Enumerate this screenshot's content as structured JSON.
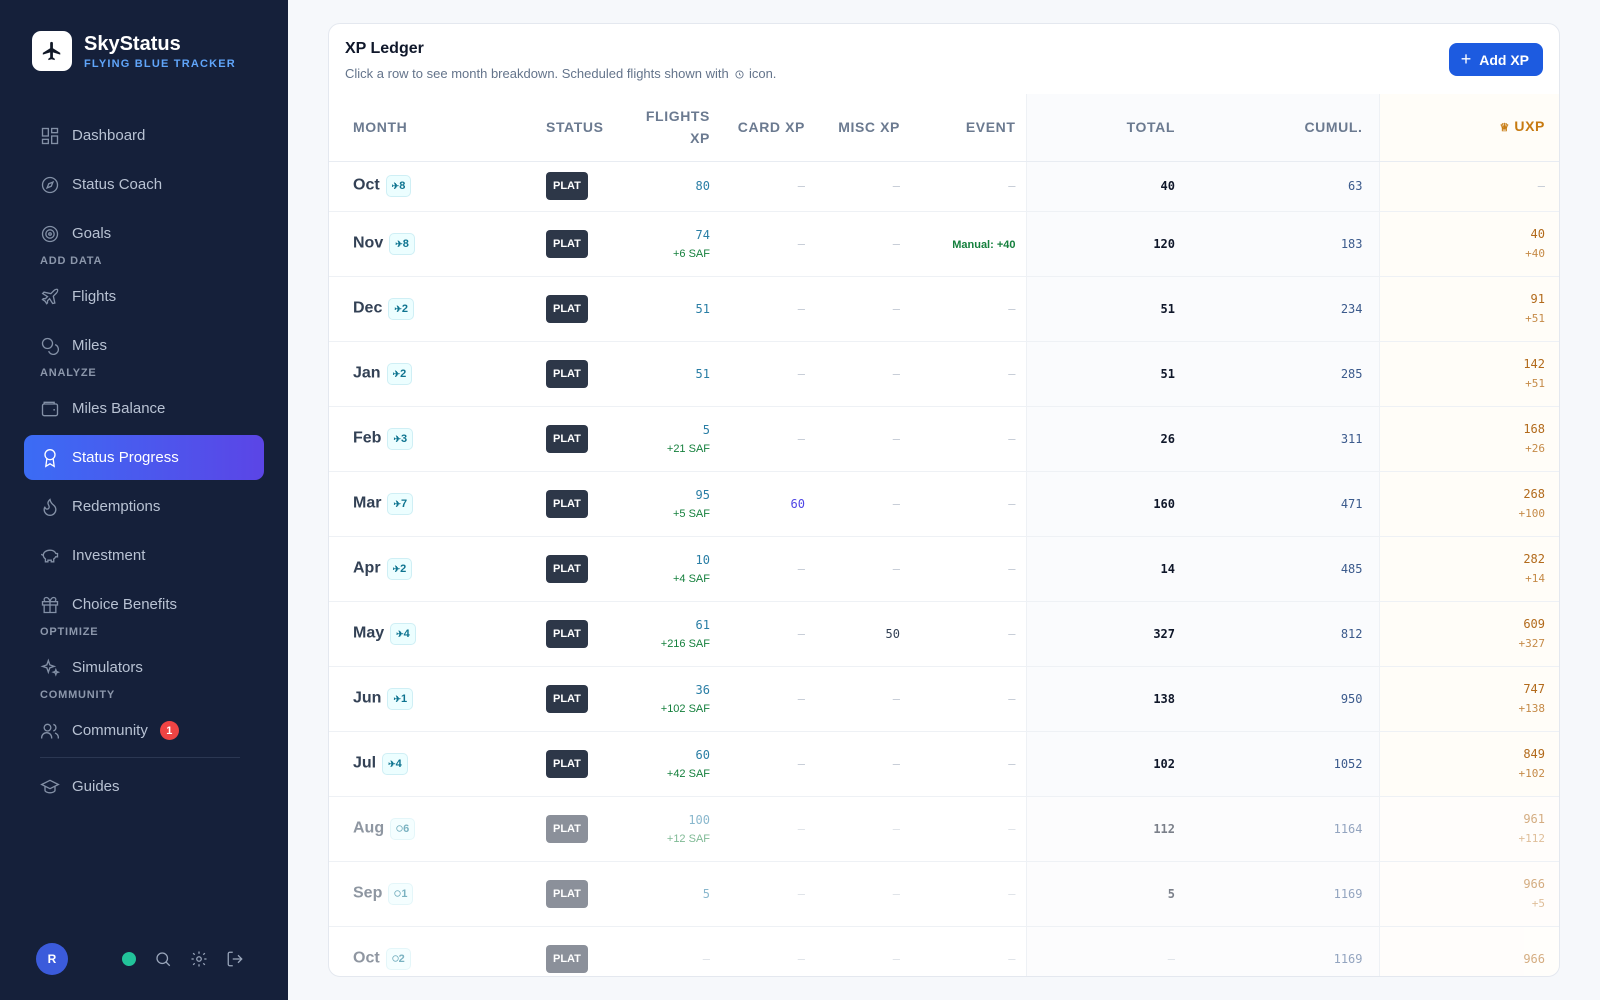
{
  "brand": {
    "name": "SkyStatus",
    "tagline": "FLYING BLUE TRACKER"
  },
  "nav": {
    "dashboard": "Dashboard",
    "status_coach": "Status Coach",
    "goals": "Goals",
    "section_add": "ADD DATA",
    "flights": "Flights",
    "miles": "Miles",
    "section_analyze": "ANALYZE",
    "miles_balance": "Miles Balance",
    "status_progress": "Status Progress",
    "redemptions": "Redemptions",
    "investment": "Investment",
    "choice_benefits": "Choice Benefits",
    "section_optimize": "OPTIMIZE",
    "simulators": "Simulators",
    "section_community": "COMMUNITY",
    "community": "Community",
    "community_badge": "1",
    "guides": "Guides"
  },
  "user": {
    "initial": "R"
  },
  "ledger": {
    "title": "XP Ledger",
    "subtitle_a": "Click a row to see month breakdown. Scheduled flights shown with",
    "subtitle_b": "icon.",
    "add_label": "Add XP",
    "headers": {
      "month": "MONTH",
      "status": "STATUS",
      "flights_a": "FLIGHTS",
      "flights_b": "XP",
      "card": "CARD XP",
      "misc": "MISC XP",
      "event": "EVENT",
      "total": "TOTAL",
      "cumul": "CUMUL.",
      "uxp": "UXP"
    },
    "rows": [
      {
        "month": "Oct",
        "pill": "8",
        "status": "PLAT",
        "flights": "80",
        "saf": "",
        "card": "–",
        "misc": "–",
        "event": "–",
        "total": "40",
        "cumul": "63",
        "uxp": "–",
        "uxp_delta": ""
      },
      {
        "month": "Nov",
        "pill": "8",
        "status": "PLAT",
        "flights": "74",
        "saf": "+6 SAF",
        "card": "–",
        "misc": "–",
        "event": "Manual: +40",
        "total": "120",
        "cumul": "183",
        "uxp": "40",
        "uxp_delta": "+40"
      },
      {
        "month": "Dec",
        "pill": "2",
        "status": "PLAT",
        "flights": "51",
        "saf": "",
        "card": "–",
        "misc": "–",
        "event": "–",
        "total": "51",
        "cumul": "234",
        "uxp": "91",
        "uxp_delta": "+51"
      },
      {
        "month": "Jan",
        "pill": "2",
        "status": "PLAT",
        "flights": "51",
        "saf": "",
        "card": "–",
        "misc": "–",
        "event": "–",
        "total": "51",
        "cumul": "285",
        "uxp": "142",
        "uxp_delta": "+51"
      },
      {
        "month": "Feb",
        "pill": "3",
        "status": "PLAT",
        "flights": "5",
        "saf": "+21 SAF",
        "card": "–",
        "misc": "–",
        "event": "–",
        "total": "26",
        "cumul": "311",
        "uxp": "168",
        "uxp_delta": "+26"
      },
      {
        "month": "Mar",
        "pill": "7",
        "status": "PLAT",
        "flights": "95",
        "saf": "+5 SAF",
        "card": "60",
        "misc": "–",
        "event": "–",
        "total": "160",
        "cumul": "471",
        "uxp": "268",
        "uxp_delta": "+100"
      },
      {
        "month": "Apr",
        "pill": "2",
        "status": "PLAT",
        "flights": "10",
        "saf": "+4 SAF",
        "card": "–",
        "misc": "–",
        "event": "–",
        "total": "14",
        "cumul": "485",
        "uxp": "282",
        "uxp_delta": "+14"
      },
      {
        "month": "May",
        "pill": "4",
        "status": "PLAT",
        "flights": "61",
        "saf": "+216 SAF",
        "card": "–",
        "misc": "50",
        "event": "–",
        "total": "327",
        "cumul": "812",
        "uxp": "609",
        "uxp_delta": "+327"
      },
      {
        "month": "Jun",
        "pill": "1",
        "status": "PLAT",
        "flights": "36",
        "saf": "+102 SAF",
        "card": "–",
        "misc": "–",
        "event": "–",
        "total": "138",
        "cumul": "950",
        "uxp": "747",
        "uxp_delta": "+138"
      },
      {
        "month": "Jul",
        "pill": "4",
        "status": "PLAT",
        "flights": "60",
        "saf": "+42 SAF",
        "card": "–",
        "misc": "–",
        "event": "–",
        "total": "102",
        "cumul": "1052",
        "uxp": "849",
        "uxp_delta": "+102"
      },
      {
        "month": "Aug",
        "pill": "6",
        "status": "PLAT",
        "flights": "100",
        "saf": "+12 SAF",
        "card": "–",
        "misc": "–",
        "event": "–",
        "total": "112",
        "cumul": "1164",
        "uxp": "961",
        "uxp_delta": "+112"
      },
      {
        "month": "Sep",
        "pill": "1",
        "status": "PLAT",
        "flights": "5",
        "saf": "",
        "card": "–",
        "misc": "–",
        "event": "–",
        "total": "5",
        "cumul": "1169",
        "uxp": "966",
        "uxp_delta": "+5"
      },
      {
        "month": "Oct",
        "pill": "2",
        "status": "PLAT",
        "flights": "–",
        "saf": "",
        "card": "–",
        "misc": "–",
        "event": "–",
        "total": "–",
        "cumul": "1169",
        "uxp": "966",
        "uxp_delta": ""
      }
    ]
  },
  "colors": {
    "sidebar_bg": "#15203a",
    "accent": "#1d5be0",
    "uxp": "#c77a10",
    "saf": "#15803d"
  }
}
